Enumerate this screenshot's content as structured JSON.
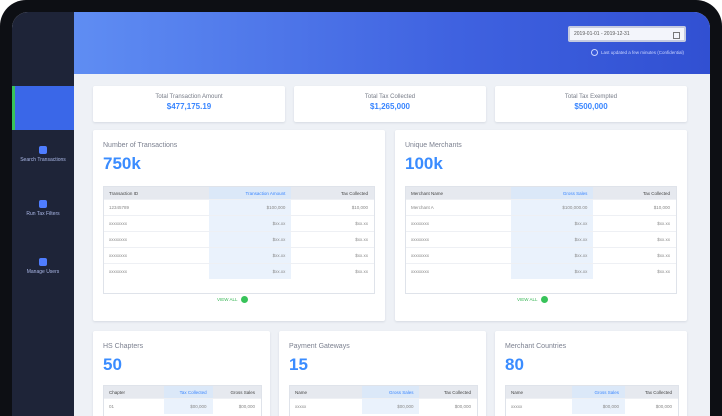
{
  "sidebar": {
    "items": [
      {
        "label": "Search Transactions",
        "icon": "search-icon"
      },
      {
        "label": "Run Tax Filters",
        "icon": "document-icon"
      },
      {
        "label": "Manage Users",
        "icon": "user-shield-icon"
      }
    ]
  },
  "header": {
    "date_range": "2019-01-01 - 2019-12-31",
    "updated": "Last updated a few minutes (Confidential)"
  },
  "stats": [
    {
      "label": "Total Transaction Amount",
      "value": "$477,175.19"
    },
    {
      "label": "Total Tax Collected",
      "value": "$1,265,000"
    },
    {
      "label": "Total Tax Exempted",
      "value": "$500,000"
    }
  ],
  "transactions": {
    "title": "Number of Transactions",
    "value": "750k",
    "columns": [
      "Transaction ID",
      "Transaction Amount",
      "Tax Collected"
    ],
    "rows": [
      [
        "12345789",
        "$100,000",
        "$10,000"
      ],
      [
        "xxxxxxxx",
        "$xx.xx",
        "$xx.xx"
      ],
      [
        "xxxxxxxx",
        "$xx.xx",
        "$xx.xx"
      ],
      [
        "xxxxxxxx",
        "$xx.xx",
        "$xx.xx"
      ],
      [
        "xxxxxxxx",
        "$xx.xx",
        "$xx.xx"
      ]
    ],
    "view_all": "VIEW ALL"
  },
  "merchants": {
    "title": "Unique Merchants",
    "value": "100k",
    "columns": [
      "Merchant Name",
      "Gross Sales",
      "Tax Collected"
    ],
    "rows": [
      [
        "Merchant A",
        "$100,000.00",
        "$10,000"
      ],
      [
        "xxxxxxxx",
        "$xx.xx",
        "$xx.xx"
      ],
      [
        "xxxxxxxx",
        "$xx.xx",
        "$xx.xx"
      ],
      [
        "xxxxxxxx",
        "$xx.xx",
        "$xx.xx"
      ],
      [
        "xxxxxxxx",
        "$xx.xx",
        "$xx.xx"
      ]
    ],
    "view_all": "VIEW ALL"
  },
  "bottom": [
    {
      "title": "HS Chapters",
      "value": "50",
      "columns": [
        "Chapter",
        "Tax Collected",
        "Gross Sales"
      ],
      "row": [
        "01",
        "$00,000",
        "$00,000"
      ]
    },
    {
      "title": "Payment Gateways",
      "value": "15",
      "columns": [
        "Name",
        "Gross Sales",
        "Tax Collected"
      ],
      "row": [
        "xxxxx",
        "$00,000",
        "$00,000"
      ]
    },
    {
      "title": "Merchant Countries",
      "value": "80",
      "columns": [
        "Name",
        "Gross Sales",
        "Tax Collected"
      ],
      "row": [
        "xxxxx",
        "$00,000",
        "$00,000"
      ]
    }
  ],
  "colors": {
    "accent": "#3a86ff",
    "header_start": "#5f8df3",
    "header_end": "#3150d2",
    "sidebar": "#1e2438",
    "success": "#38c35a"
  }
}
